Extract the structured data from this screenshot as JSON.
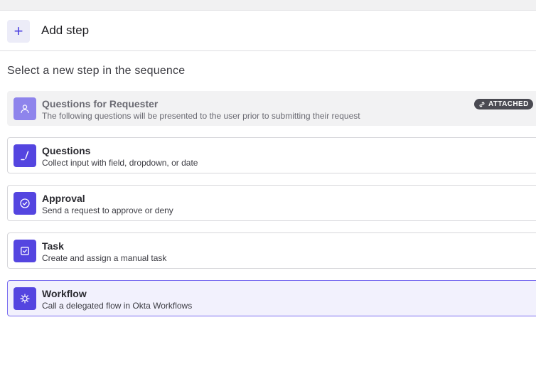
{
  "header": {
    "add_icon": "plus-icon",
    "add_glyph": "+",
    "title": "Add step"
  },
  "section": {
    "title": "Select a new step in the sequence"
  },
  "steps": [
    {
      "title": "Questions for Requester",
      "description": "The following questions will be presented to the user prior to submitting their request",
      "icon": "person-icon",
      "badge": "ATTACHED",
      "state": "attached"
    },
    {
      "title": "Questions",
      "description": "Collect input with field, dropdown, or date",
      "icon": "pencil-field-icon",
      "state": "default"
    },
    {
      "title": "Approval",
      "description": "Send a request to approve or deny",
      "icon": "check-circle-icon",
      "state": "default"
    },
    {
      "title": "Task",
      "description": "Create and assign a manual task",
      "icon": "check-square-icon",
      "state": "default"
    },
    {
      "title": "Workflow",
      "description": "Call a delegated flow in Okta Workflows",
      "icon": "workflow-gear-icon",
      "state": "selected"
    }
  ],
  "colors": {
    "accent": "#5445e0",
    "accent_light": "#ececf8",
    "badge": "#4a4a52"
  }
}
